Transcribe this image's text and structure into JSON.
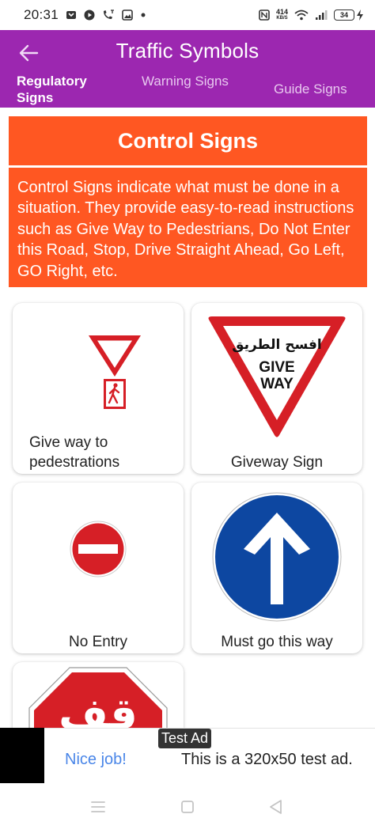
{
  "status_bar": {
    "time": "20:31",
    "speed_value": "414",
    "speed_unit": "KB/S",
    "battery": "34"
  },
  "app_bar": {
    "title": "Traffic Symbols",
    "back_icon": "arrow-left-icon",
    "tabs": [
      {
        "label": "Regulatory Signs",
        "active": true
      },
      {
        "label": "Warning Signs",
        "active": false
      },
      {
        "label": "Guide Signs",
        "active": false
      }
    ]
  },
  "section": {
    "title": "Control Signs",
    "description": "Control Signs indicate what must be done in a situation. They provide easy-to-read instructions such as Give Way to Pedestrians, Do Not Enter this Road, Stop, Drive Straight Ahead, Go Left, GO Right, etc."
  },
  "signs": [
    {
      "label": "Give way to pedestrations",
      "icon": "give-way-pedestrian-sign"
    },
    {
      "label": "Giveway Sign",
      "icon": "give-way-sign",
      "sign_text_arabic": "افسح الطريق",
      "sign_text_line1": "GIVE",
      "sign_text_line2": "WAY"
    },
    {
      "label": "No Entry",
      "icon": "no-entry-sign"
    },
    {
      "label": "Must go this way",
      "icon": "ahead-only-sign"
    },
    {
      "label": "",
      "icon": "stop-sign",
      "sign_text_arabic": "قف"
    }
  ],
  "ad": {
    "badge": "Test Ad",
    "headline": "Nice job!",
    "text": "This is a 320x50 test ad."
  },
  "colors": {
    "app_bar": "#9c27b0",
    "section": "#ff5722",
    "sign_red": "#d61f26",
    "sign_blue": "#0d47a1",
    "ad_link": "#4a86e8"
  }
}
